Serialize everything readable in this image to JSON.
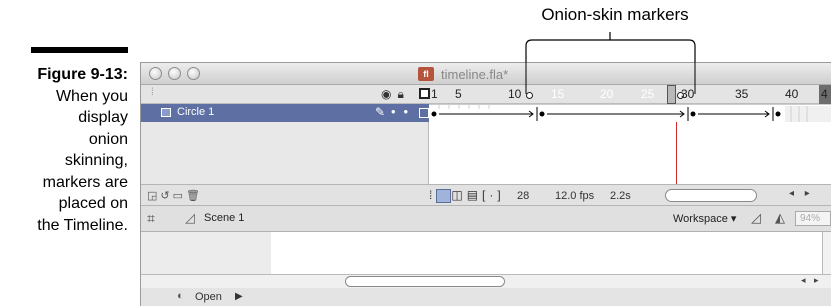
{
  "caption": {
    "figure_label": "Figure 9-13:",
    "lines": [
      "When you",
      "display",
      "onion",
      "skinning,",
      "markers are",
      "placed on",
      "the Timeline."
    ]
  },
  "callout": {
    "label": "Onion-skin markers"
  },
  "window": {
    "title": "timeline.fla*",
    "doc_icon_label": "fl"
  },
  "timeline": {
    "ruler_numbers": [
      "1",
      "5",
      "10",
      "15",
      "20",
      "25",
      "30",
      "35",
      "40",
      "4"
    ],
    "layer": {
      "name": "Circle 1"
    },
    "status": {
      "frame": "28",
      "fps": "12.0 fps",
      "time": "2.2s"
    }
  },
  "editbar": {
    "scene": "Scene 1",
    "workspace": "Workspace ▾",
    "zoom": "94%"
  },
  "properties": {
    "label": "Open"
  },
  "icons": {
    "eye": "eye-icon",
    "lock": "lock-icon",
    "outline": "outline-icon",
    "pencil": "pencil-icon",
    "stage": "stage-icon",
    "scene": "scene-icon"
  },
  "colors": {
    "layer_selected": "#5d6fa3",
    "onion_band": "#6d6d6d"
  }
}
